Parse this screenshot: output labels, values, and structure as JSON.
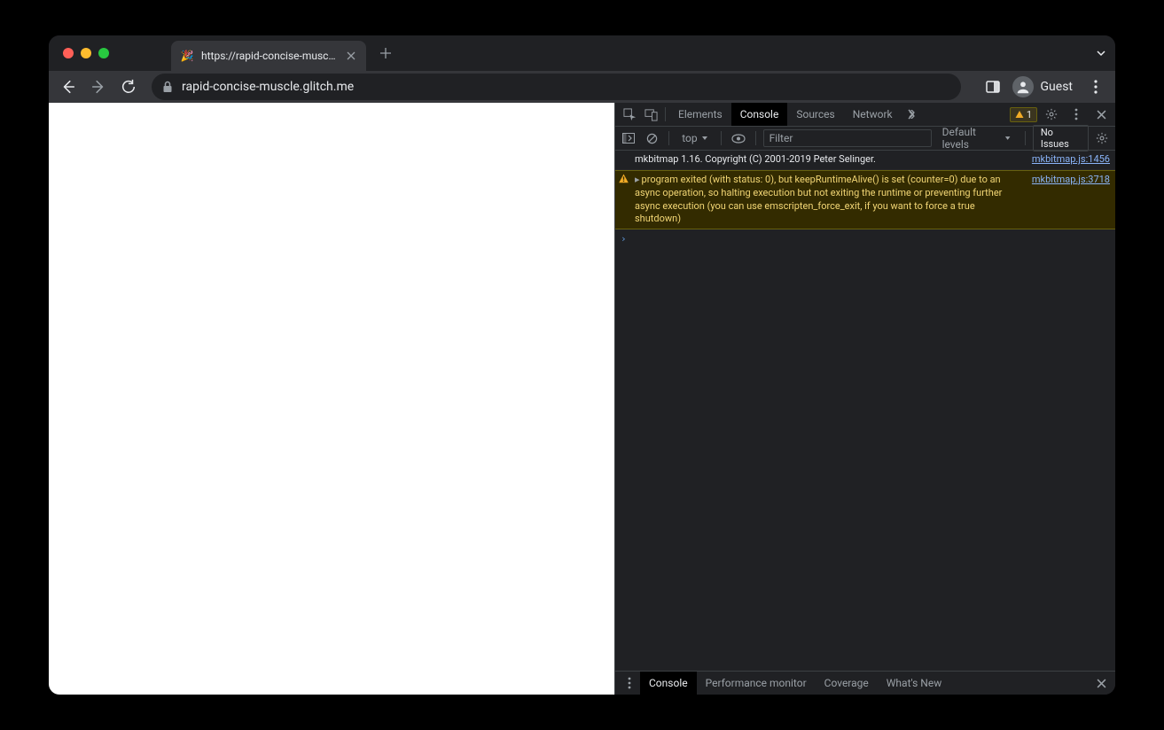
{
  "tab": {
    "title": "https://rapid-concise-muscle.g",
    "favicon": "🎉"
  },
  "address": {
    "url": "rapid-concise-muscle.glitch.me"
  },
  "profile": {
    "label": "Guest"
  },
  "devtools": {
    "tabs": [
      "Elements",
      "Console",
      "Sources",
      "Network"
    ],
    "active_tab": "Console",
    "warn_count": "1",
    "console": {
      "context": "top",
      "filter_placeholder": "Filter",
      "levels": "Default levels",
      "issues": "No Issues"
    },
    "logs": [
      {
        "type": "log",
        "msg": "mkbitmap 1.16. Copyright (C) 2001-2019 Peter Selinger.",
        "src": "mkbitmap.js:1456"
      },
      {
        "type": "warn",
        "msg": "program exited (with status: 0), but keepRuntimeAlive() is set (counter=0) due to an async operation, so halting execution but not exiting the runtime or preventing further async execution (you can use emscripten_force_exit, if you want to force a true shutdown)",
        "src": "mkbitmap.js:3718"
      }
    ],
    "drawer_tabs": [
      "Console",
      "Performance monitor",
      "Coverage",
      "What's New"
    ],
    "drawer_active": "Console"
  }
}
